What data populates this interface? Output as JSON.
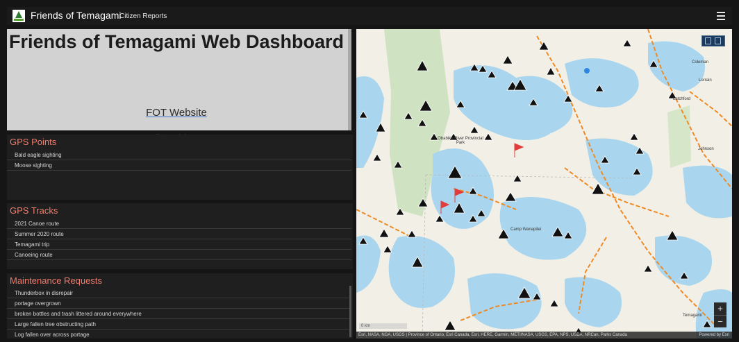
{
  "header": {
    "title": "Friends of Temagami",
    "subtitle": "Citizen Reports"
  },
  "intro": {
    "title": "Friends of Temagami Web Dashboard",
    "links": [
      "FOT Website",
      "StoryMap"
    ]
  },
  "gps_points": {
    "title": "GPS Points",
    "items": [
      "Bald eagle sighting",
      "Moose sighting"
    ]
  },
  "gps_tracks": {
    "title": "GPS Tracks",
    "items": [
      "2021 Canoe route",
      "Summer 2020 route",
      "Temagami trip",
      "Canoeing route"
    ]
  },
  "maintenance": {
    "title": "Maintenance Requests",
    "items": [
      "Thunderbox in disrepair",
      "portage overgrown",
      "broken bottles and trash littered around everywhere",
      "Large fallen tree obstructing path",
      "Log fallen over across portage"
    ]
  },
  "map": {
    "attribution": "Esri, NASA, NGA, USGS | Province of Ontario, Esri Canada, Esri, HERE, Garmin, METI/NASA, USGS, EPA, NPS, USDA, NRCan, Parks Canada",
    "powered_by": "Powered by Esri",
    "scale_label": "0 km",
    "place_labels": {
      "coleman": "Coleman",
      "latchford": "Latchford",
      "johnson": "Johnson",
      "lorrain": "Lorrain",
      "obabika": "Obabika River Provincial Park",
      "camp": "Camp Wanapitei",
      "temagami": "Temagami"
    },
    "zoom_in": "+",
    "zoom_out": "−",
    "colors": {
      "water": "#a9d6ee",
      "land": "#f2efe6",
      "park": "#cfe3c2",
      "road": "#f08a24",
      "marker": "#111111",
      "flag": "#e23c3c"
    }
  }
}
